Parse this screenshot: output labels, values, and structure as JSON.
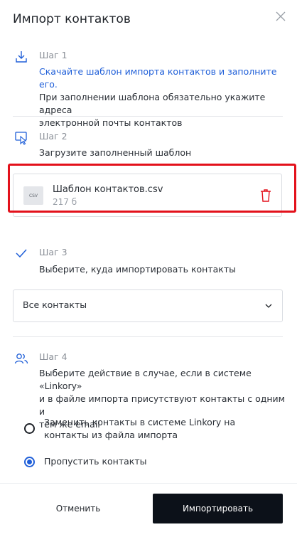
{
  "dialog": {
    "title": "Импорт контактов"
  },
  "step1": {
    "label": "Шаг 1",
    "link_text": "Скачайте шаблон импорта контактов и заполните его.",
    "desc_line2": "При заполнении шаблона обязательно укажите адреса",
    "desc_line3": "электронной почты контактов"
  },
  "step2": {
    "label": "Шаг 2",
    "desc": "Загрузите заполненный шаблон",
    "file": {
      "type_badge": "CSV",
      "name": "Шаблон контактов.csv",
      "size": "217 б"
    }
  },
  "step3": {
    "label": "Шаг 3",
    "desc": "Выберите, куда импортировать контакты",
    "select_value": "Все контакты"
  },
  "step4": {
    "label": "Шаг 4",
    "desc_line1": "Выберите действие в случае, если в системе «Linkory»",
    "desc_line2": "и в файле импорта присутствуют контакты с одним и",
    "desc_line3": "тем же email",
    "options": [
      {
        "line1": "Заменить контакты в системе Linkory на",
        "line2": "контакты из файла импорта",
        "selected": false
      },
      {
        "line1": "Пропустить контакты",
        "selected": true
      }
    ]
  },
  "footer": {
    "cancel_label": "Отменить",
    "import_label": "Импортировать"
  },
  "colors": {
    "accent": "#1e5ed8",
    "danger": "#e3111b",
    "primary_button": "#0c1119"
  },
  "icons": {
    "close": "close-icon",
    "step1": "download-icon",
    "step2": "upload-cursor-icon",
    "step3": "checkmark-icon",
    "step4": "users-icon",
    "delete": "trash-icon",
    "select": "chevron-down-icon"
  }
}
